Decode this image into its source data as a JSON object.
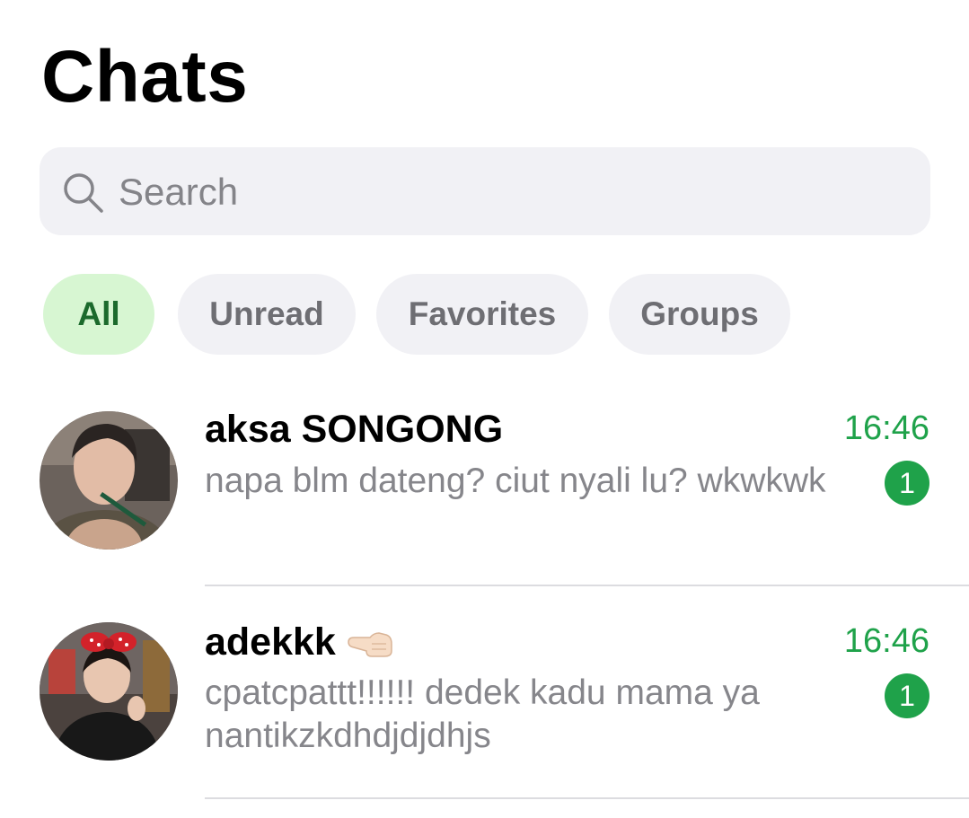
{
  "header": {
    "title": "Chats"
  },
  "search": {
    "placeholder": "Search",
    "value": ""
  },
  "filters": [
    {
      "label": "All",
      "active": true
    },
    {
      "label": "Unread",
      "active": false
    },
    {
      "label": "Favorites",
      "active": false
    },
    {
      "label": "Groups",
      "active": false
    }
  ],
  "chats": [
    {
      "name": "aksa SONGONG",
      "preview": "napa blm dateng? ciut nyali lu? wkwkwk",
      "time": "16:46",
      "unread": "1"
    },
    {
      "name": "adekkk",
      "name_emoji": "pointing-left-hand-emoji",
      "preview": "cpatcpattt!!!!!! dedek kadu mama ya nantikzkdhdjdjdhjs",
      "time": "16:46",
      "unread": "1"
    }
  ],
  "colors": {
    "accent_green": "#1fa24a",
    "active_chip_bg": "#d7f6d2",
    "active_chip_text": "#1b6a2c",
    "chip_bg": "#f1f1f5",
    "secondary_text": "#86868b"
  }
}
